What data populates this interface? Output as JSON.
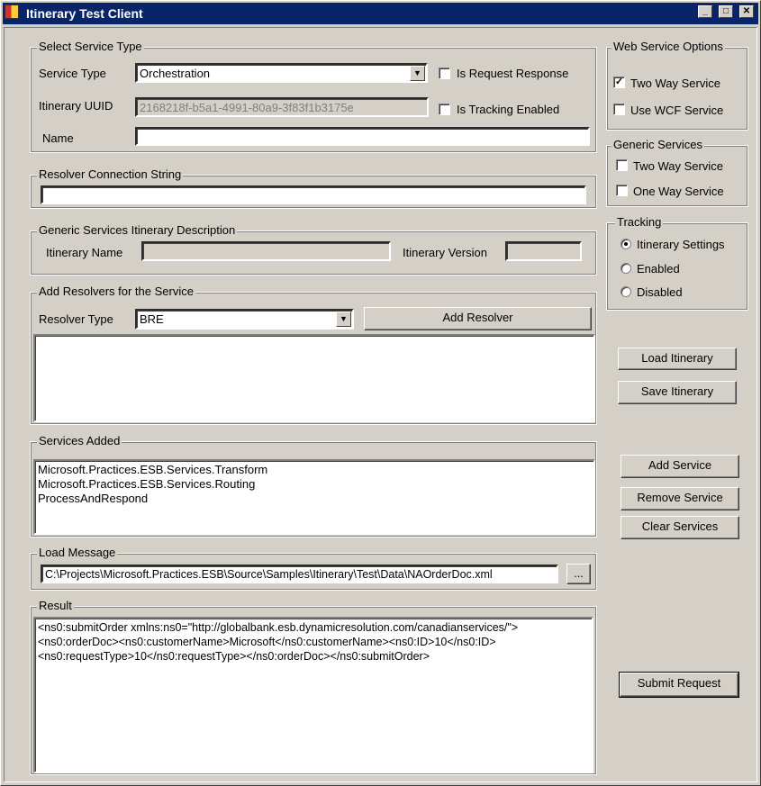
{
  "window": {
    "title": "Itinerary Test Client",
    "controls": [
      "_",
      "□",
      "✕"
    ]
  },
  "select_service_type": {
    "legend": "Select Service Type",
    "service_type_label": "Service Type",
    "service_type_value": "Orchestration",
    "is_request_response": {
      "label": "Is Request Response",
      "checked": false
    },
    "uuid_label": "Itinerary UUID",
    "uuid_value": "2168218f-b5a1-4991-80a9-3f83f1b3175e",
    "is_tracking_enabled": {
      "label": "Is Tracking Enabled",
      "checked": false
    },
    "name_label": "Name",
    "name_value": ""
  },
  "resolver_connection": {
    "legend": "Resolver Connection String",
    "value": ""
  },
  "generic_desc": {
    "legend": "Generic Services Itinerary Description",
    "name_label": "Itinerary Name",
    "name_value": "",
    "version_label": "Itinerary Version",
    "version_value": ""
  },
  "add_resolvers": {
    "legend": "Add Resolvers for the Service",
    "type_label": "Resolver Type",
    "type_value": "BRE",
    "add_button": "Add Resolver",
    "items": []
  },
  "services_added": {
    "legend": "Services Added",
    "items": [
      "Microsoft.Practices.ESB.Services.Transform",
      "Microsoft.Practices.ESB.Services.Routing",
      "ProcessAndRespond"
    ]
  },
  "load_message": {
    "legend": "Load Message",
    "path": "C:\\Projects\\Microsoft.Practices.ESB\\Source\\Samples\\Itinerary\\Test\\Data\\NAOrderDoc.xml",
    "browse": "..."
  },
  "result": {
    "legend": "Result",
    "lines": [
      "<ns0:submitOrder xmlns:ns0=\"http://globalbank.esb.dynamicresolution.com/canadianservices/\">",
      "<ns0:orderDoc><ns0:customerName>Microsoft</ns0:customerName><ns0:ID>10</ns0:ID>",
      "<ns0:requestType>10</ns0:requestType></ns0:orderDoc></ns0:submitOrder>"
    ]
  },
  "web_service_options": {
    "legend": "Web Service Options",
    "two_way": {
      "label": "Two Way Service",
      "checked": true
    },
    "use_wcf": {
      "label": "Use WCF Service",
      "checked": false
    }
  },
  "generic_services": {
    "legend": "Generic Services",
    "two_way": {
      "label": "Two Way Service",
      "checked": false
    },
    "one_way": {
      "label": "One Way Service",
      "checked": false
    }
  },
  "tracking": {
    "legend": "Tracking",
    "options": [
      "Itinerary Settings",
      "Enabled",
      "Disabled"
    ],
    "selected": "Itinerary Settings"
  },
  "buttons": {
    "load_itinerary": "Load Itinerary",
    "save_itinerary": "Save Itinerary",
    "add_service": "Add Service",
    "remove_service": "Remove Service",
    "clear_services": "Clear Services",
    "submit_request": "Submit Request"
  }
}
